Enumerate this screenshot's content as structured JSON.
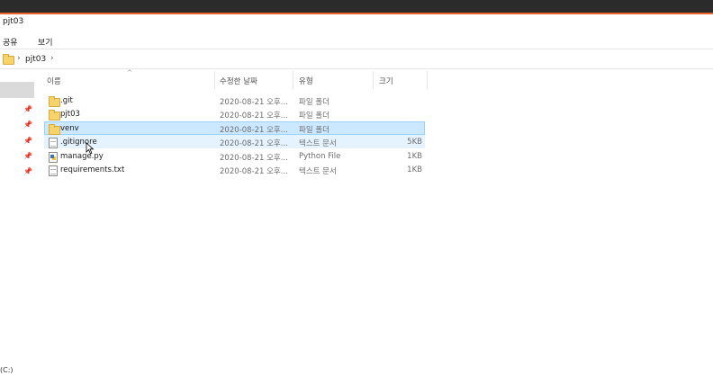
{
  "window": {
    "title": "pjt03"
  },
  "ribbon": {
    "tabs": [
      "공유",
      "보기"
    ]
  },
  "address": {
    "segments": [
      "pjt03"
    ],
    "sep": "›"
  },
  "nav": {
    "drive_label": "(C:)",
    "pins": [
      "pin-icon",
      "pin-icon",
      "pin-icon",
      "pin-icon",
      "pin-icon"
    ]
  },
  "columns": {
    "name": "이름",
    "date": "수정한 날짜",
    "type": "유형",
    "size": "크기"
  },
  "files": [
    {
      "name": ".git",
      "date": "2020-08-21 오후...",
      "type": "파일 폴더",
      "size": "",
      "icon": "folder-icon",
      "state": ""
    },
    {
      "name": "pjt03",
      "date": "2020-08-21 오후...",
      "type": "파일 폴더",
      "size": "",
      "icon": "folder-icon",
      "state": ""
    },
    {
      "name": "venv",
      "date": "2020-08-21 오후...",
      "type": "파일 폴더",
      "size": "",
      "icon": "folder-icon",
      "state": "selected"
    },
    {
      "name": ".gitignore",
      "date": "2020-08-21 오후...",
      "type": "텍스트 문서",
      "size": "5KB",
      "icon": "text-file-icon",
      "state": "hover"
    },
    {
      "name": "manage.py",
      "date": "2020-08-21 오후...",
      "type": "Python File",
      "size": "1KB",
      "icon": "python-file-icon",
      "state": ""
    },
    {
      "name": "requirements.txt",
      "date": "2020-08-21 오후...",
      "type": "텍스트 문서",
      "size": "1KB",
      "icon": "text-file-icon",
      "state": ""
    }
  ],
  "colors": {
    "accent": "#e8662b",
    "selection": "#cce8ff",
    "hover": "#e5f3ff"
  }
}
